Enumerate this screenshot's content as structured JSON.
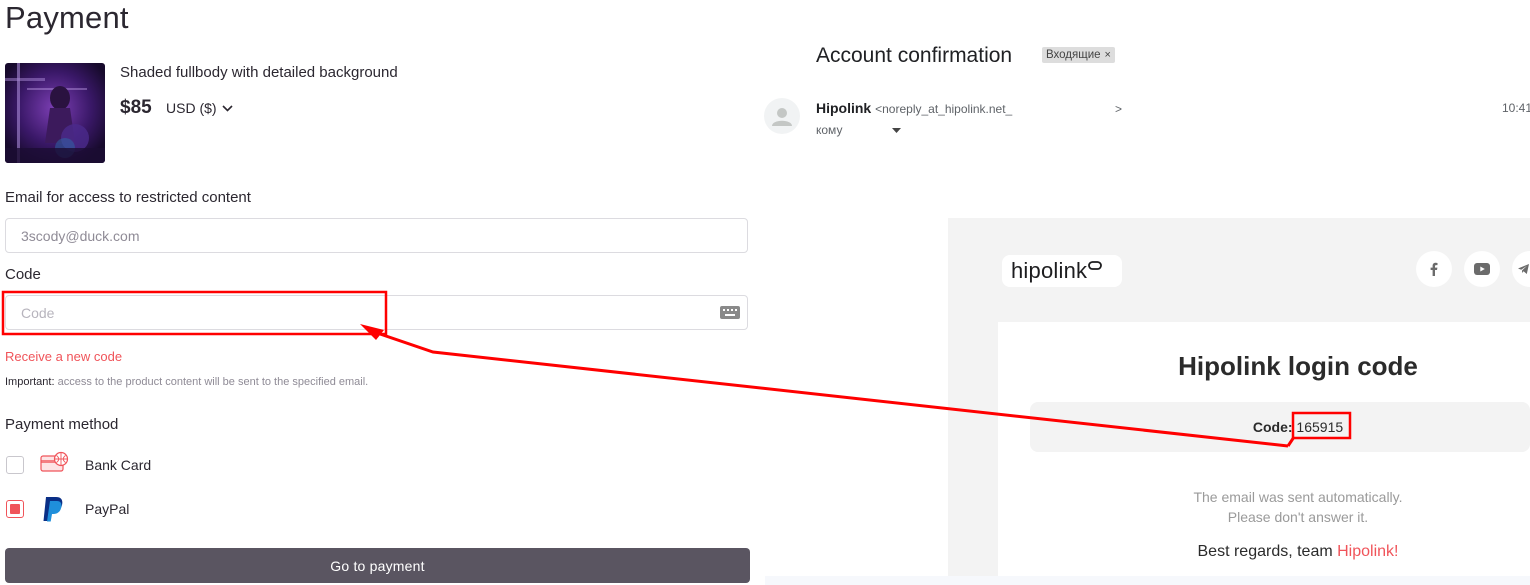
{
  "payment": {
    "title": "Payment",
    "product": {
      "name": "Shaded fullbody with detailed background",
      "price": "$85",
      "currency": "USD ($)"
    },
    "email_label": "Email for access to restricted content",
    "email_value": "3scody@duck.com",
    "code_label": "Code",
    "code_placeholder": "Code",
    "resend_label": "Receive a new code",
    "important_prefix": "Important:",
    "important_text": "access to the product content will be sent to the specified email.",
    "method_title": "Payment method",
    "methods": [
      {
        "label": "Bank Card",
        "checked": false,
        "icon": "bank-card-icon"
      },
      {
        "label": "PayPal",
        "checked": true,
        "icon": "paypal-icon"
      }
    ],
    "submit_label": "Go to payment",
    "accent_color": "#f0545a"
  },
  "mail": {
    "subject": "Account confirmation",
    "label_chip": "Входящие",
    "chip_close": "×",
    "sender_name": "Hipolink",
    "sender_addr": "<noreply_at_hipolink.net_",
    "sender_addr_end": ">",
    "to_label": "кому",
    "time": "10:41",
    "body": {
      "logo_text": "hipolink",
      "heading": "Hipolink login code",
      "code_label": "Code:",
      "code_value": "165915",
      "auto_line1": "The email was sent automatically.",
      "auto_line2": "Please don't answer it.",
      "regards_text": "Best regards, team",
      "regards_brand": "Hipolink!",
      "social_icons": [
        "facebook-icon",
        "youtube-icon",
        "telegram-icon"
      ]
    }
  },
  "annotation_color": "#ff0000"
}
